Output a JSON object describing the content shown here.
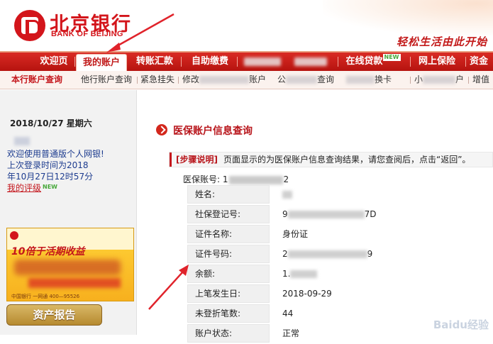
{
  "header": {
    "logo_cn": "北京银行",
    "logo_en": "BANK OF BEIJING",
    "slogan": "轻松生活由此开始"
  },
  "nav": {
    "items": [
      {
        "label": "欢迎页"
      },
      {
        "label": "我的账户",
        "active": true
      },
      {
        "label": "转账汇款"
      },
      {
        "label": "自助缴费"
      },
      {
        "label": "在线贷款",
        "badge": "NEW"
      },
      {
        "label": "网上保险"
      },
      {
        "label": "资金"
      }
    ]
  },
  "subnav": {
    "items": [
      {
        "label": "本行账户查询",
        "active": true
      },
      {
        "label": "他行账户查询"
      },
      {
        "label": "紧急挂失"
      },
      {
        "label": "修改"
      },
      {
        "label": "账户"
      },
      {
        "label": "公"
      },
      {
        "label": "查询"
      },
      {
        "label": "换卡"
      },
      {
        "label": "小"
      },
      {
        "label": "户"
      },
      {
        "label": "增值"
      }
    ]
  },
  "sidebar": {
    "date": "2018/10/27 星期六",
    "welcome": "欢迎使用普通版个人网银!",
    "last_login_1": "上次登录时间为2018",
    "last_login_2": "年10月27日12时57分",
    "my_rating": "我的评级",
    "rating_badge": "NEW",
    "banner_title": "10倍于活期收益",
    "banner_phone": "中国银行 一网通 400—95526",
    "report_button": "资产报告"
  },
  "main": {
    "title": "医保账户信息查询",
    "steps_label": "[步骤说明]",
    "steps_text": "页面显示的为医保账户信息查询结果，请您查阅后，点击“返回”。",
    "account_label": "医保账号:",
    "account_prefix": "1",
    "account_suffix": "2",
    "rows": [
      {
        "label": "姓名:",
        "value": ""
      },
      {
        "label": "社保登记号:",
        "value": "9",
        "value_suffix": "7D"
      },
      {
        "label": "证件名称:",
        "value": "身份证"
      },
      {
        "label": "证件号码:",
        "value": "2",
        "value_suffix": "9"
      },
      {
        "label": "余额:",
        "value": "1."
      },
      {
        "label": "上笔发生日:",
        "value": "2018-09-29"
      },
      {
        "label": "未登折笔数:",
        "value": "44"
      },
      {
        "label": "账户状态:",
        "value": "正常"
      }
    ]
  },
  "watermark": "Baidu经验",
  "colors": {
    "brand_red": "#d3151b",
    "nav_red": "#c11a1a",
    "sidebar_bg": "#f2f2f2",
    "link_blue": "#1d3c8f"
  }
}
